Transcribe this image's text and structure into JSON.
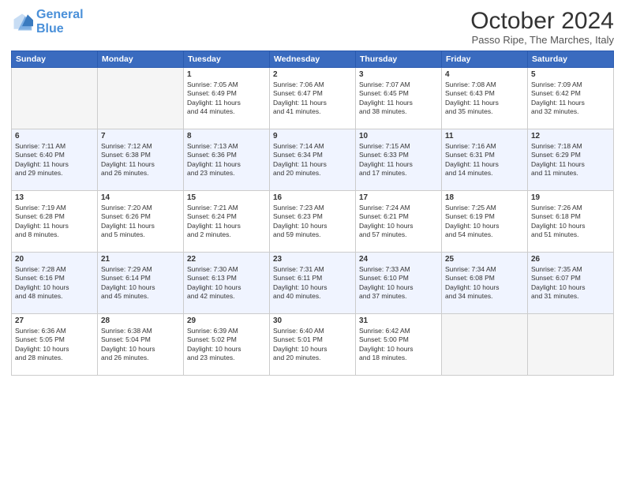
{
  "header": {
    "logo_line1": "General",
    "logo_line2": "Blue",
    "month": "October 2024",
    "location": "Passo Ripe, The Marches, Italy"
  },
  "weekdays": [
    "Sunday",
    "Monday",
    "Tuesday",
    "Wednesday",
    "Thursday",
    "Friday",
    "Saturday"
  ],
  "weeks": [
    [
      {
        "day": "",
        "info": ""
      },
      {
        "day": "",
        "info": ""
      },
      {
        "day": "1",
        "info": "Sunrise: 7:05 AM\nSunset: 6:49 PM\nDaylight: 11 hours\nand 44 minutes."
      },
      {
        "day": "2",
        "info": "Sunrise: 7:06 AM\nSunset: 6:47 PM\nDaylight: 11 hours\nand 41 minutes."
      },
      {
        "day": "3",
        "info": "Sunrise: 7:07 AM\nSunset: 6:45 PM\nDaylight: 11 hours\nand 38 minutes."
      },
      {
        "day": "4",
        "info": "Sunrise: 7:08 AM\nSunset: 6:43 PM\nDaylight: 11 hours\nand 35 minutes."
      },
      {
        "day": "5",
        "info": "Sunrise: 7:09 AM\nSunset: 6:42 PM\nDaylight: 11 hours\nand 32 minutes."
      }
    ],
    [
      {
        "day": "6",
        "info": "Sunrise: 7:11 AM\nSunset: 6:40 PM\nDaylight: 11 hours\nand 29 minutes."
      },
      {
        "day": "7",
        "info": "Sunrise: 7:12 AM\nSunset: 6:38 PM\nDaylight: 11 hours\nand 26 minutes."
      },
      {
        "day": "8",
        "info": "Sunrise: 7:13 AM\nSunset: 6:36 PM\nDaylight: 11 hours\nand 23 minutes."
      },
      {
        "day": "9",
        "info": "Sunrise: 7:14 AM\nSunset: 6:34 PM\nDaylight: 11 hours\nand 20 minutes."
      },
      {
        "day": "10",
        "info": "Sunrise: 7:15 AM\nSunset: 6:33 PM\nDaylight: 11 hours\nand 17 minutes."
      },
      {
        "day": "11",
        "info": "Sunrise: 7:16 AM\nSunset: 6:31 PM\nDaylight: 11 hours\nand 14 minutes."
      },
      {
        "day": "12",
        "info": "Sunrise: 7:18 AM\nSunset: 6:29 PM\nDaylight: 11 hours\nand 11 minutes."
      }
    ],
    [
      {
        "day": "13",
        "info": "Sunrise: 7:19 AM\nSunset: 6:28 PM\nDaylight: 11 hours\nand 8 minutes."
      },
      {
        "day": "14",
        "info": "Sunrise: 7:20 AM\nSunset: 6:26 PM\nDaylight: 11 hours\nand 5 minutes."
      },
      {
        "day": "15",
        "info": "Sunrise: 7:21 AM\nSunset: 6:24 PM\nDaylight: 11 hours\nand 2 minutes."
      },
      {
        "day": "16",
        "info": "Sunrise: 7:23 AM\nSunset: 6:23 PM\nDaylight: 10 hours\nand 59 minutes."
      },
      {
        "day": "17",
        "info": "Sunrise: 7:24 AM\nSunset: 6:21 PM\nDaylight: 10 hours\nand 57 minutes."
      },
      {
        "day": "18",
        "info": "Sunrise: 7:25 AM\nSunset: 6:19 PM\nDaylight: 10 hours\nand 54 minutes."
      },
      {
        "day": "19",
        "info": "Sunrise: 7:26 AM\nSunset: 6:18 PM\nDaylight: 10 hours\nand 51 minutes."
      }
    ],
    [
      {
        "day": "20",
        "info": "Sunrise: 7:28 AM\nSunset: 6:16 PM\nDaylight: 10 hours\nand 48 minutes."
      },
      {
        "day": "21",
        "info": "Sunrise: 7:29 AM\nSunset: 6:14 PM\nDaylight: 10 hours\nand 45 minutes."
      },
      {
        "day": "22",
        "info": "Sunrise: 7:30 AM\nSunset: 6:13 PM\nDaylight: 10 hours\nand 42 minutes."
      },
      {
        "day": "23",
        "info": "Sunrise: 7:31 AM\nSunset: 6:11 PM\nDaylight: 10 hours\nand 40 minutes."
      },
      {
        "day": "24",
        "info": "Sunrise: 7:33 AM\nSunset: 6:10 PM\nDaylight: 10 hours\nand 37 minutes."
      },
      {
        "day": "25",
        "info": "Sunrise: 7:34 AM\nSunset: 6:08 PM\nDaylight: 10 hours\nand 34 minutes."
      },
      {
        "day": "26",
        "info": "Sunrise: 7:35 AM\nSunset: 6:07 PM\nDaylight: 10 hours\nand 31 minutes."
      }
    ],
    [
      {
        "day": "27",
        "info": "Sunrise: 6:36 AM\nSunset: 5:05 PM\nDaylight: 10 hours\nand 28 minutes."
      },
      {
        "day": "28",
        "info": "Sunrise: 6:38 AM\nSunset: 5:04 PM\nDaylight: 10 hours\nand 26 minutes."
      },
      {
        "day": "29",
        "info": "Sunrise: 6:39 AM\nSunset: 5:02 PM\nDaylight: 10 hours\nand 23 minutes."
      },
      {
        "day": "30",
        "info": "Sunrise: 6:40 AM\nSunset: 5:01 PM\nDaylight: 10 hours\nand 20 minutes."
      },
      {
        "day": "31",
        "info": "Sunrise: 6:42 AM\nSunset: 5:00 PM\nDaylight: 10 hours\nand 18 minutes."
      },
      {
        "day": "",
        "info": ""
      },
      {
        "day": "",
        "info": ""
      }
    ]
  ]
}
